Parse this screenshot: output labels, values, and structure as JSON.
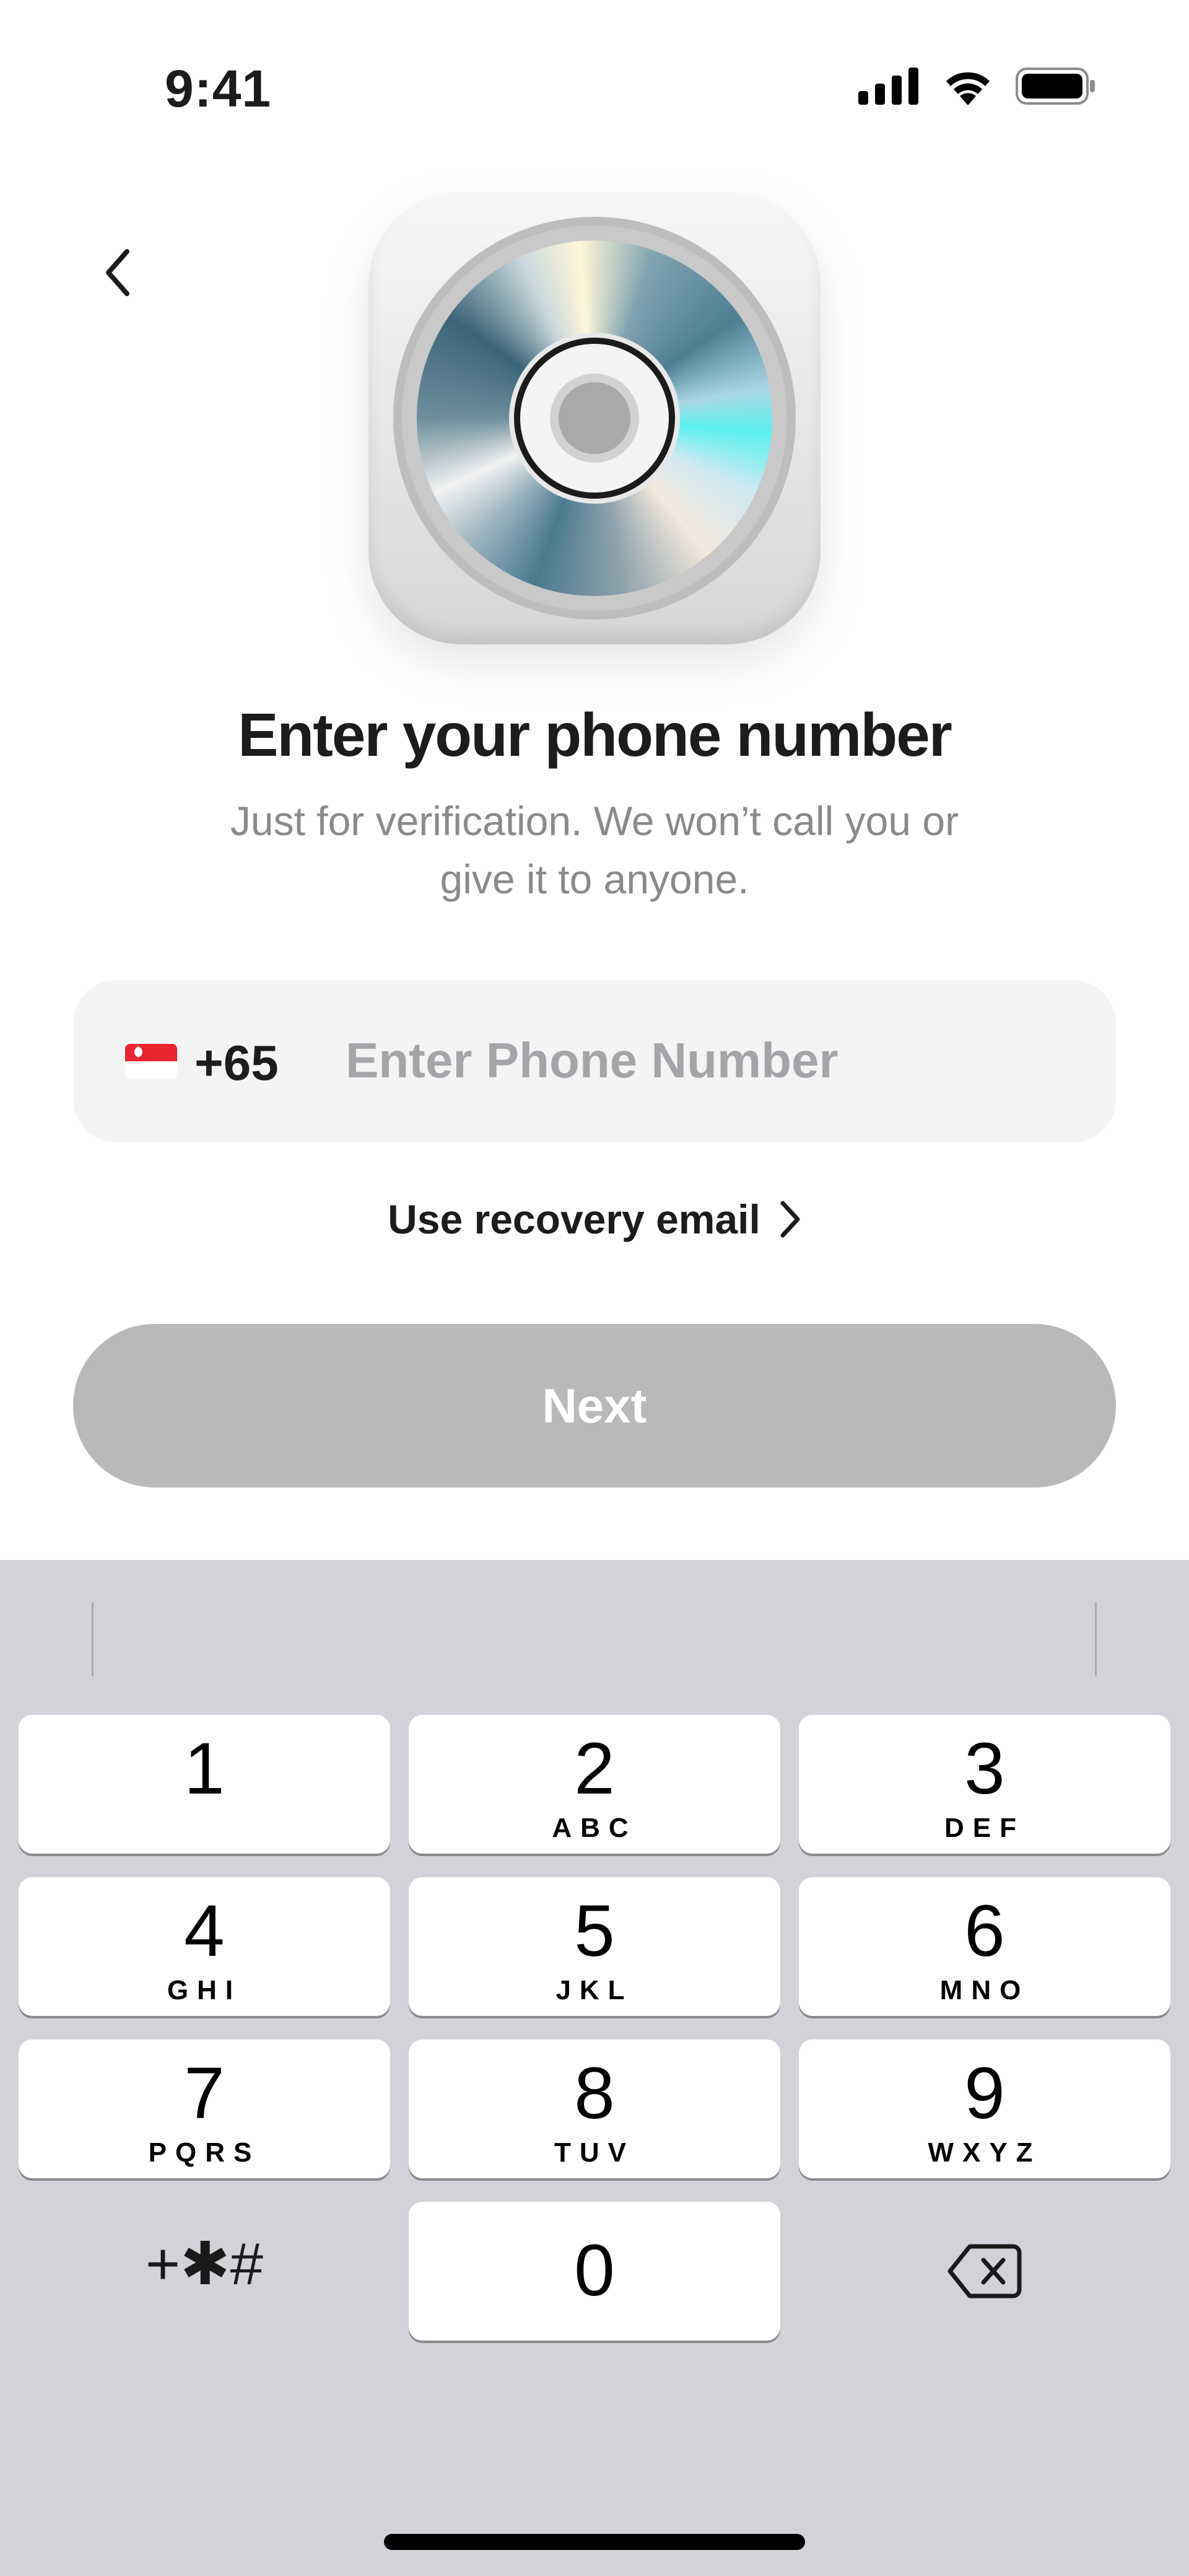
{
  "status_bar": {
    "time": "9:41"
  },
  "screen": {
    "title": "Enter your phone number",
    "subtitle": "Just for verification. We won’t call you or give it to anyone."
  },
  "phone": {
    "country_code": "+65",
    "flag_icon": "singapore-flag-icon",
    "value": "",
    "placeholder": "Enter Phone Number"
  },
  "recovery": {
    "label": "Use recovery email"
  },
  "next_button": {
    "label": "Next",
    "color": "#b9b9bb"
  },
  "keyboard": {
    "keys": [
      {
        "digit": "1",
        "letters": ""
      },
      {
        "digit": "2",
        "letters": "ABC"
      },
      {
        "digit": "3",
        "letters": "DEF"
      },
      {
        "digit": "4",
        "letters": "GHI"
      },
      {
        "digit": "5",
        "letters": "JKL"
      },
      {
        "digit": "6",
        "letters": "MNO"
      },
      {
        "digit": "7",
        "letters": "PQRS"
      },
      {
        "digit": "8",
        "letters": "TUV"
      },
      {
        "digit": "9",
        "letters": "WXYZ"
      },
      {
        "digit": "0",
        "letters": ""
      }
    ],
    "symbols_label": "+✱#",
    "background": "#d1d3d9"
  }
}
